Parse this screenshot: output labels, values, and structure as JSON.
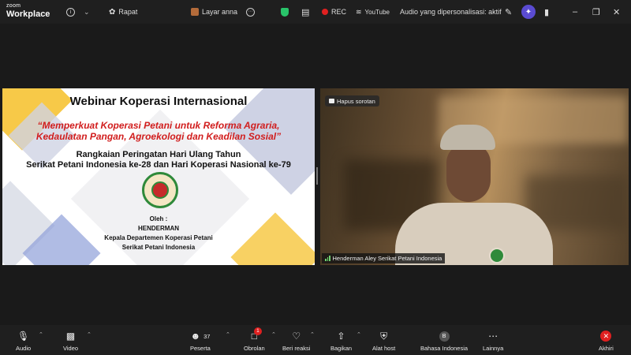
{
  "app": {
    "brand_top": "zoom",
    "brand_bottom": "Workplace"
  },
  "topbar": {
    "meeting_tab": "Rapat",
    "share_tab": "Layar anna",
    "rec_label": "REC",
    "youtube_label": "YouTube",
    "audio_label": "Audio yang dipersonalisasi: aktif"
  },
  "slide": {
    "title": "Webinar Koperasi Internasional",
    "quote_line1": "“Memperkuat Koperasi Petani untuk Reforma Agraria,",
    "quote_line2": "Kedaulatan Pangan, Agroekologi dan Keadilan Sosial”",
    "sub_line1": "Rangkaian Peringatan Hari Ulang Tahun",
    "sub_line2": "Serikat Petani Indonesia ke-28 dan Hari Koperasi Nasional ke-79",
    "by_label": "Oleh :",
    "speaker": "HENDERMAN",
    "position": "Kepala Departemen Koperasi Petani",
    "organization": "Serikat Petani Indonesia"
  },
  "video": {
    "spotlight_button": "Hapus sorotan",
    "participant_name": "Henderman Aley Serikat Petani Indonesia"
  },
  "toolbar": {
    "audio": "Audio",
    "video": "Video",
    "participants": "Peserta",
    "participant_count": "37",
    "chat": "Obrolan",
    "chat_badge": "1",
    "react": "Beri reaksi",
    "share": "Bagikan",
    "host_tools": "Alat host",
    "language": "Bahasa Indonesia",
    "language_initial": "B",
    "more": "Lainnya",
    "end": "Akhiri"
  },
  "colors": {
    "accent_red": "#d11d1d",
    "end_red": "#e02020",
    "mic_muted": "#e03a3a"
  }
}
